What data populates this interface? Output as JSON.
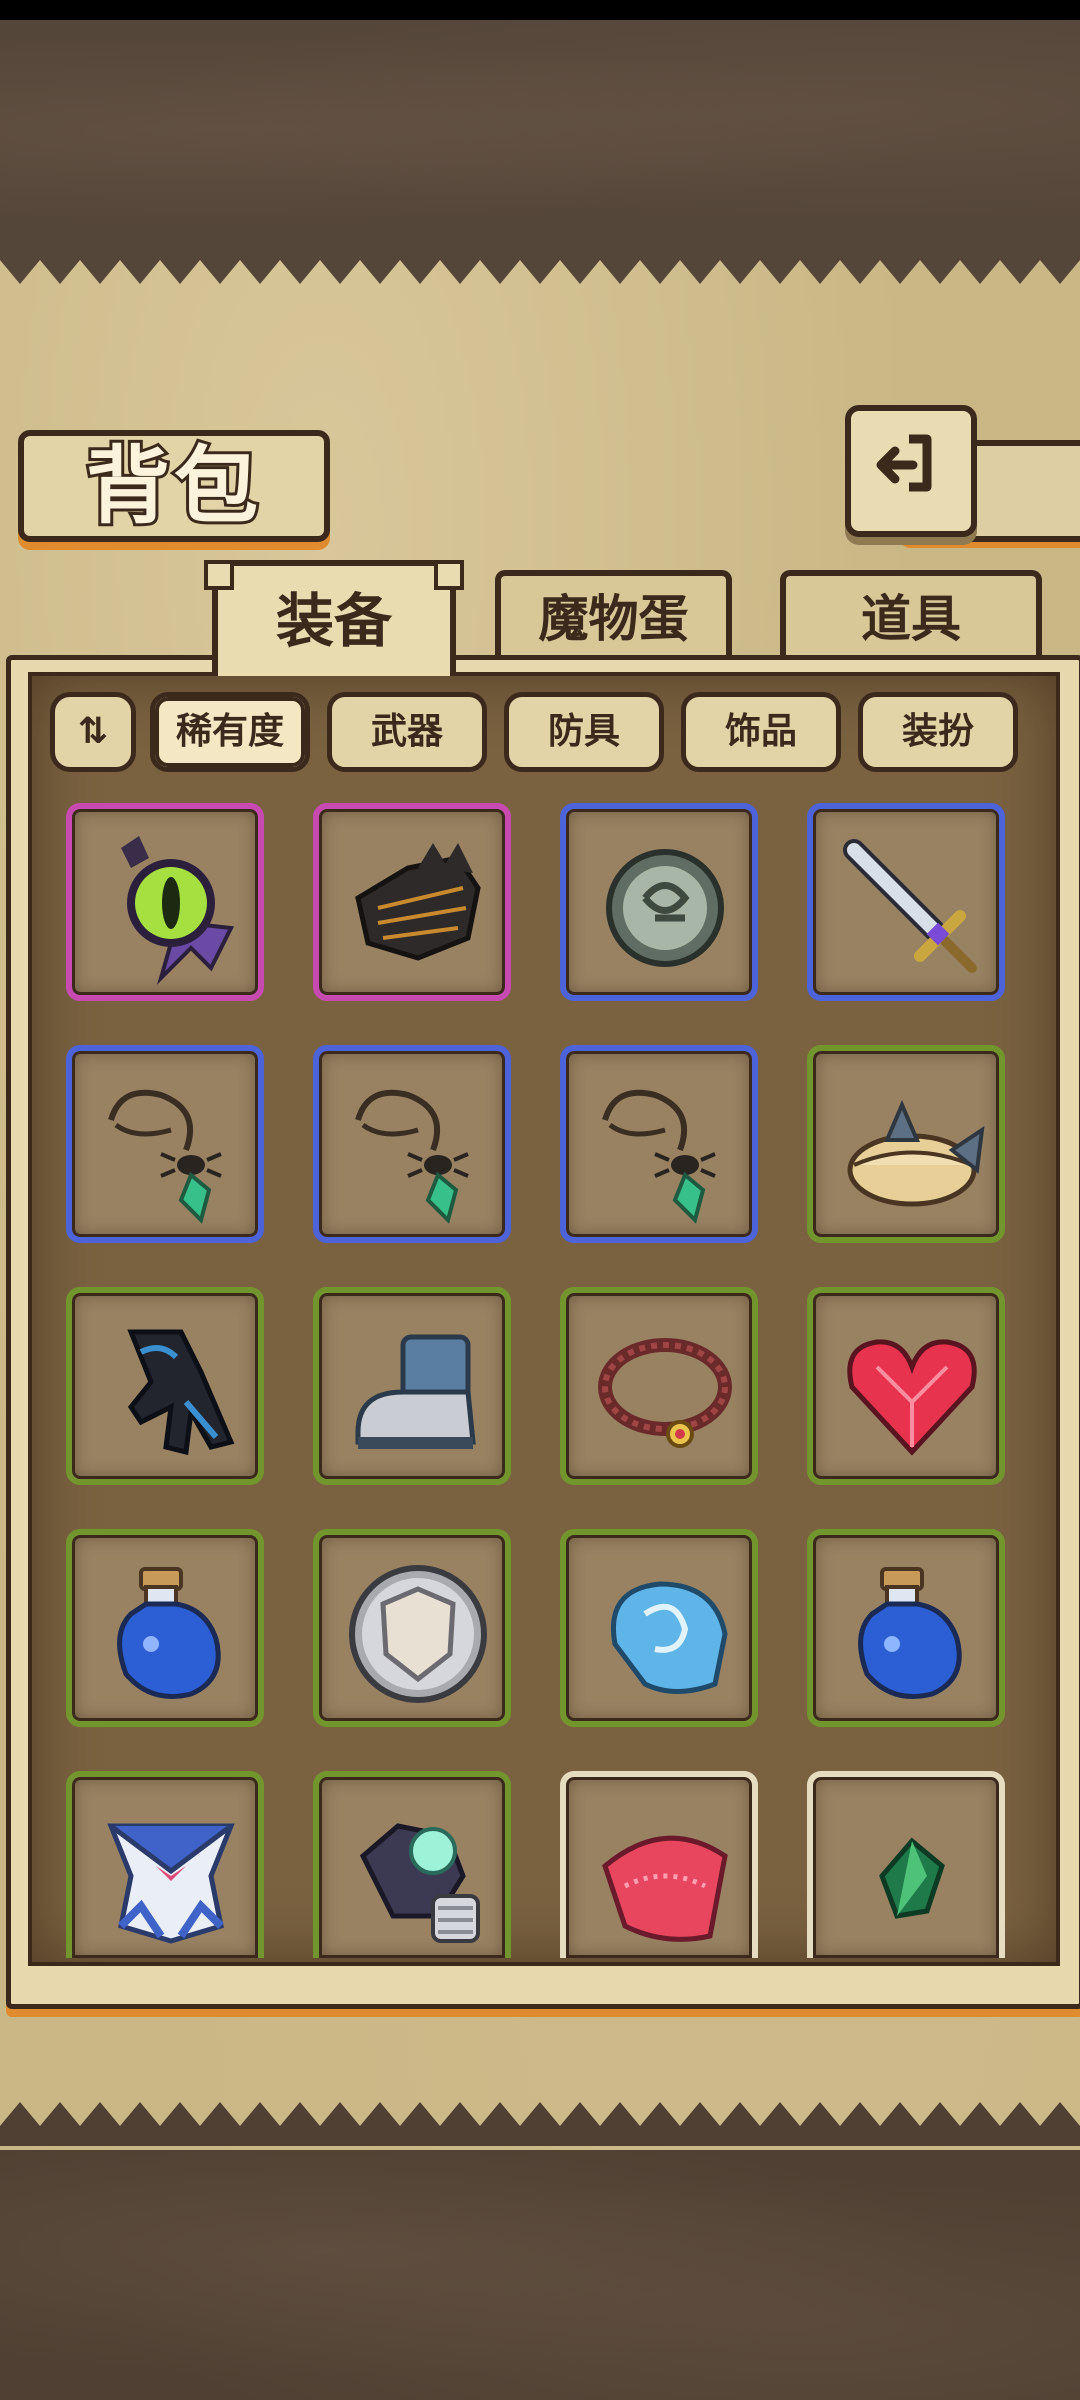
{
  "header": {
    "title": "背包"
  },
  "tabs": [
    {
      "label": "装备",
      "active": true
    },
    {
      "label": "魔物蛋",
      "active": false
    },
    {
      "label": "道具",
      "active": false
    }
  ],
  "filters": {
    "toggle_icon": "sort-toggle-icon",
    "chips": [
      {
        "label": "稀有度",
        "active": true
      },
      {
        "label": "武器",
        "active": false
      },
      {
        "label": "防具",
        "active": false
      },
      {
        "label": "饰品",
        "active": false
      },
      {
        "label": "装扮",
        "active": false
      }
    ]
  },
  "rarity_colors": {
    "purple": "#c64ab0",
    "blue": "#4c63d9",
    "green": "#73952e",
    "white": "#e6dcc0"
  },
  "inventory": [
    {
      "icon": "eye-staff-icon",
      "rarity": "purple"
    },
    {
      "icon": "dark-gauntlet-icon",
      "rarity": "purple"
    },
    {
      "icon": "stone-coin-icon",
      "rarity": "blue"
    },
    {
      "icon": "sword-icon",
      "rarity": "blue"
    },
    {
      "icon": "spider-necklace-icon",
      "rarity": "blue"
    },
    {
      "icon": "spider-necklace-icon",
      "rarity": "blue"
    },
    {
      "icon": "spider-necklace-icon",
      "rarity": "blue"
    },
    {
      "icon": "fish-pie-icon",
      "rarity": "green"
    },
    {
      "icon": "dark-glove-icon",
      "rarity": "green"
    },
    {
      "icon": "metal-boot-icon",
      "rarity": "green"
    },
    {
      "icon": "leather-collar-icon",
      "rarity": "green"
    },
    {
      "icon": "heart-gem-icon",
      "rarity": "green"
    },
    {
      "icon": "blue-potion-icon",
      "rarity": "green"
    },
    {
      "icon": "round-shield-icon",
      "rarity": "green"
    },
    {
      "icon": "blue-shell-icon",
      "rarity": "green"
    },
    {
      "icon": "blue-potion-icon",
      "rarity": "green"
    },
    {
      "icon": "sailor-outfit-icon",
      "rarity": "green"
    },
    {
      "icon": "crystal-glove-icon",
      "rarity": "green"
    },
    {
      "icon": "pink-skirt-icon",
      "rarity": "white"
    },
    {
      "icon": "green-crystal-icon",
      "rarity": "white"
    }
  ]
}
